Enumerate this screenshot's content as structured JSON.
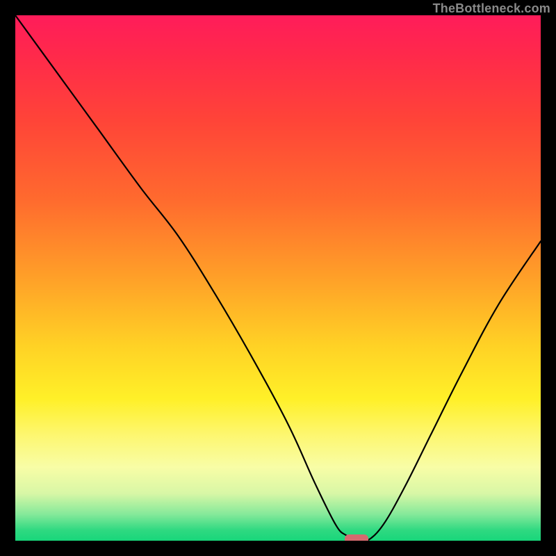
{
  "watermark": "TheBottleneck.com",
  "chart_data": {
    "type": "line",
    "title": "",
    "xlabel": "",
    "ylabel": "",
    "xlim": [
      0,
      100
    ],
    "ylim": [
      0,
      100
    ],
    "grid": false,
    "legend": false,
    "annotations": [],
    "background_gradient": {
      "direction": "vertical",
      "stops": [
        {
          "pos": 0.0,
          "color": "#ff1c5a"
        },
        {
          "pos": 0.2,
          "color": "#ff4438"
        },
        {
          "pos": 0.5,
          "color": "#ffa028"
        },
        {
          "pos": 0.73,
          "color": "#fff028"
        },
        {
          "pos": 0.86,
          "color": "#f8fda6"
        },
        {
          "pos": 0.95,
          "color": "#84e99a"
        },
        {
          "pos": 1.0,
          "color": "#18d67a"
        }
      ]
    },
    "series": [
      {
        "name": "bottleneck-curve",
        "x": [
          0,
          8,
          16,
          24,
          31,
          38,
          45,
          52,
          57,
          61,
          63,
          65,
          67,
          70,
          74,
          79,
          85,
          92,
          100
        ],
        "y": [
          100,
          89,
          78,
          67,
          58,
          47,
          35,
          22,
          11,
          3,
          1,
          0,
          0,
          3,
          10,
          20,
          32,
          45,
          57
        ]
      }
    ],
    "marker": {
      "x": 65,
      "y": 0,
      "width": 4.5,
      "height": 1.8,
      "color": "#d56a6f"
    }
  }
}
